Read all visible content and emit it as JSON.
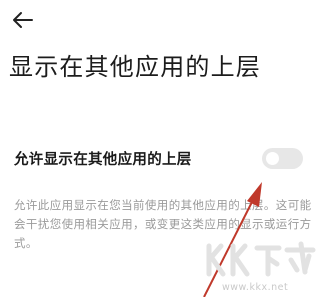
{
  "header": {
    "back_icon": "arrow-left-icon"
  },
  "page": {
    "title": "显示在其他应用的上层"
  },
  "setting": {
    "label": "允许显示在其他应用的上层",
    "enabled": false
  },
  "description": "允许此应用显示在您当前使用的其他应用的上层。这可能会干扰您使用相关应用，或变更这类应用的显示或运行方式。",
  "watermark": {
    "logo_text": "KK下载",
    "url": "www.kkx.net"
  },
  "annotation": {
    "arrow_color": "#c0392b",
    "arrow_icon": "red-arrow-pointer"
  },
  "colors": {
    "toggle_off_track": "#e7e7e7",
    "description_text": "#9a9a9a"
  }
}
